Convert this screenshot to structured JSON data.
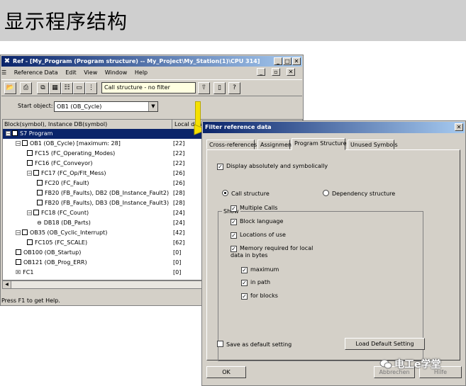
{
  "banner": {
    "title": "显示程序结构"
  },
  "ref_window": {
    "title": "Ref - [My_Program (Program structure) -- My_Project\\My_Station(1)\\CPU 314]",
    "menu": [
      "Reference Data",
      "Edit",
      "View",
      "Window",
      "Help"
    ],
    "filter_text": "Call structure - no filter",
    "start_object_label": "Start object:",
    "start_object_value": "OB1 (OB_Cycle)",
    "columns": [
      "Block(symbol), Instance DB(symbol)",
      "Local data"
    ],
    "rows": [
      {
        "label": "S7 Program",
        "value": "",
        "indent": 0,
        "kind": "expander",
        "selected": true
      },
      {
        "label": "OB1 (OB_Cycle) [maximum: 28]",
        "value": "[22]",
        "indent": 1,
        "kind": "expander"
      },
      {
        "label": "FC15 (FC_Operating_Modes)",
        "value": "[22]",
        "indent": 2,
        "kind": "box"
      },
      {
        "label": "FC16 (FC_Conveyor)",
        "value": "[22]",
        "indent": 2,
        "kind": "box"
      },
      {
        "label": "FC17 (FC_Op/Flt_Mess)",
        "value": "[26]",
        "indent": 2,
        "kind": "expander"
      },
      {
        "label": "FC20 (FC_Fault)",
        "value": "[26]",
        "indent": 3,
        "kind": "box"
      },
      {
        "label": "FB20 (FB_Faults), DB2 (DB_Instance_Fault2)",
        "value": "[28]",
        "indent": 3,
        "kind": "box"
      },
      {
        "label": "FB20 (FB_Faults), DB3 (DB_Instance_Fault3)",
        "value": "[28]",
        "indent": 3,
        "kind": "box"
      },
      {
        "label": "FC18 (FC_Count)",
        "value": "[24]",
        "indent": 2,
        "kind": "expander"
      },
      {
        "label": "DB18 (DB_Parts)",
        "value": "[24]",
        "indent": 3,
        "kind": "db"
      },
      {
        "label": "OB35 (OB_Cyclic_Interrupt)",
        "value": "[42]",
        "indent": 1,
        "kind": "expander"
      },
      {
        "label": "FC105 (FC_SCALE)",
        "value": "[62]",
        "indent": 2,
        "kind": "box"
      },
      {
        "label": "OB100 (OB_Startup)",
        "value": "[0]",
        "indent": 1,
        "kind": "box"
      },
      {
        "label": "OB121 (OB_Prog_ERR)",
        "value": "[0]",
        "indent": 1,
        "kind": "box"
      },
      {
        "label": "FC1",
        "value": "[0]",
        "indent": 1,
        "kind": "xbox"
      }
    ],
    "status": "Press F1 to get Help."
  },
  "filter_dialog": {
    "title": "Filter reference data",
    "tabs": [
      "Cross-references",
      "Assignment",
      "Program Structure",
      "Unused Symbols"
    ],
    "active_tab": "Program Structure",
    "display_abs_sym": "Display absolutely and symbolically",
    "show_label": "Show",
    "call_structure": "Call structure",
    "dependency_structure": "Dependency structure",
    "multiple_calls": "Multiple Calls",
    "block_language": "Block language",
    "locations_of_use": "Locations of use",
    "memory_required": "Memory required for local data in bytes",
    "maximum": "maximum",
    "in_path": "in path",
    "for_blocks": "for blocks",
    "save_default": "Save as default setting",
    "load_default": "Load Default Setting",
    "ok": "OK",
    "partial_button_1": "Abbrechen",
    "partial_button_2": "Hilfe"
  },
  "watermark": "电工e学堂"
}
